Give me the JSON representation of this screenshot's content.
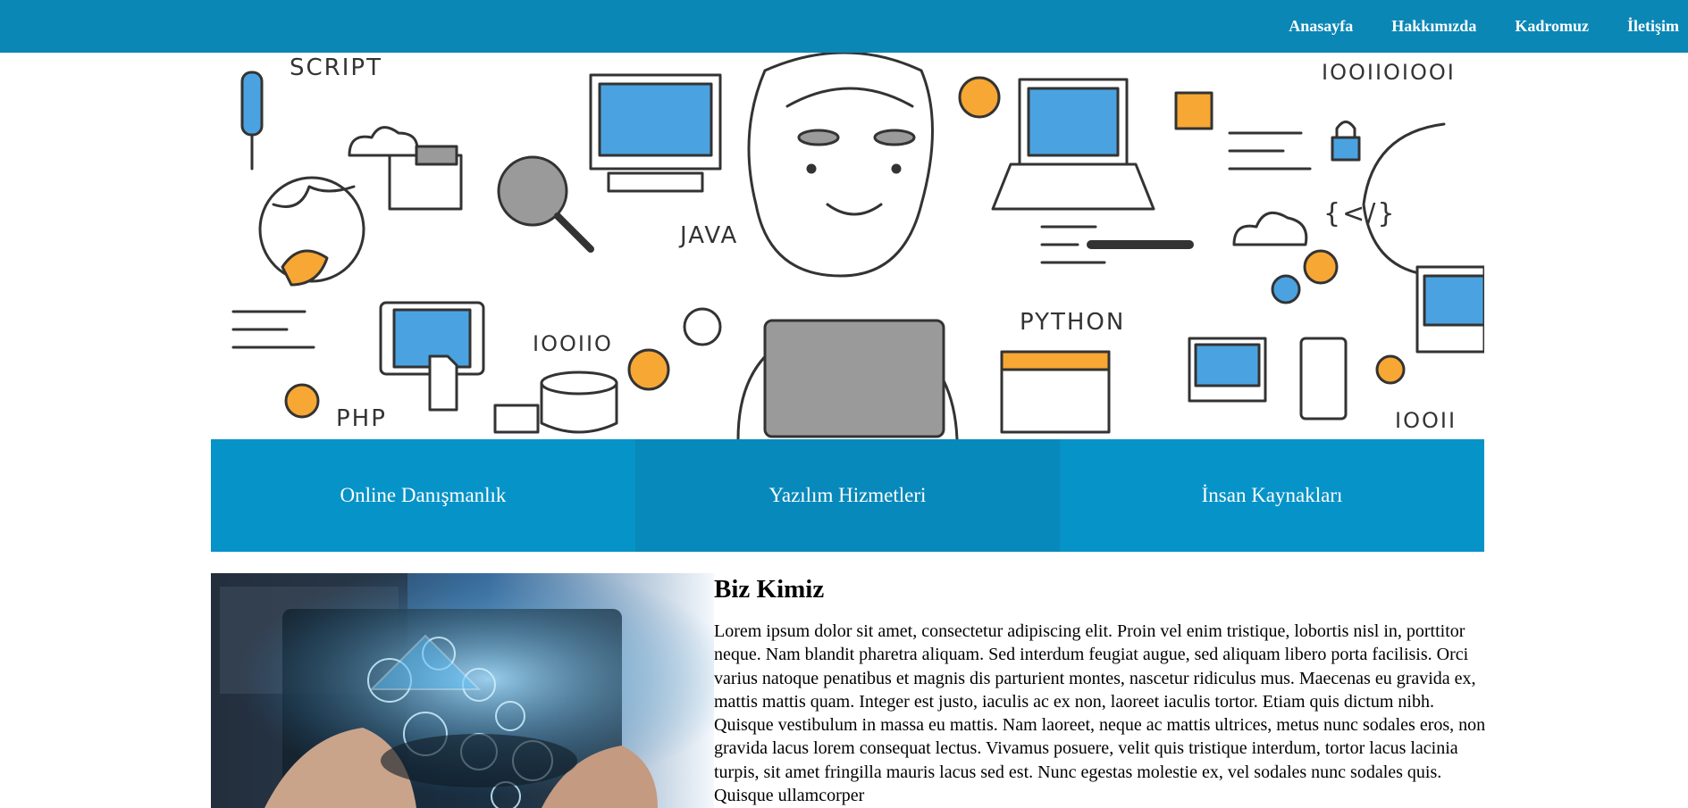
{
  "nav": {
    "items": [
      {
        "label": "Anasayfa"
      },
      {
        "label": "Hakkımızda"
      },
      {
        "label": "Kadromuz"
      },
      {
        "label": "İletişim"
      }
    ]
  },
  "hero": {
    "labels": {
      "script": "SCRIPT",
      "java": "JAVA",
      "python": "PYTHON",
      "php": "PHP",
      "binary1": "IOOIIOIOOI",
      "binary2": "IOOIIO",
      "binary3": "IOOII",
      "code": "{</}"
    }
  },
  "services": [
    {
      "label": "Online Danışmanlık"
    },
    {
      "label": "Yazılım Hizmetleri"
    },
    {
      "label": "İnsan Kaynakları"
    }
  ],
  "about": {
    "title": "Biz Kimiz",
    "body": "Lorem ipsum dolor sit amet, consectetur adipiscing elit. Proin vel enim tristique, lobortis nisl in, porttitor neque. Nam blandit pharetra aliquam. Sed interdum feugiat augue, sed aliquam libero porta facilisis. Orci varius natoque penatibus et magnis dis parturient montes, nascetur ridiculus mus. Maecenas eu gravida ex, mattis mattis quam. Integer est justo, iaculis ac ex non, laoreet iaculis tortor. Etiam quis dictum nibh. Quisque vestibulum in massa eu mattis. Nam laoreet, neque ac mattis ultrices, metus nunc sodales eros, non gravida lacus lorem consequat lectus. Vivamus posuere, velit quis tristique interdum, tortor lacus lacinia turpis, sit amet fringilla mauris lacus sed est. Nunc egestas molestie ex, vel sodales nunc sodales quis. Quisque ullamcorper"
  },
  "colors": {
    "nav_bg": "#0b87b6",
    "service_bg": "#0693c8",
    "service_active_bg": "#0789bb",
    "illustration_blue": "#4aa3e0",
    "illustration_orange": "#f7a733",
    "illustration_gray": "#9a9a9a"
  }
}
